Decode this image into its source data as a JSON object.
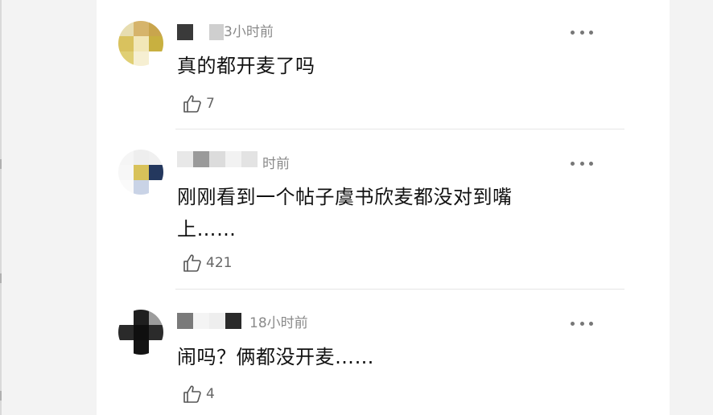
{
  "comments": [
    {
      "time": "3小时前",
      "text": "真的都开麦了吗",
      "likes": "7"
    },
    {
      "time": "时前",
      "text": "刚刚看到一个帖子虞书欣麦都没对到嘴上……",
      "likes": "421"
    },
    {
      "time": "18小时前",
      "text": "闹吗？俩都没开麦……",
      "likes": "4"
    }
  ],
  "icons": {
    "like": "thumbs-up-icon",
    "more": "more-horizontal-icon"
  },
  "colors": {
    "text": "#111111",
    "meta": "#8a8a8a",
    "divider": "#e6e6e6"
  }
}
